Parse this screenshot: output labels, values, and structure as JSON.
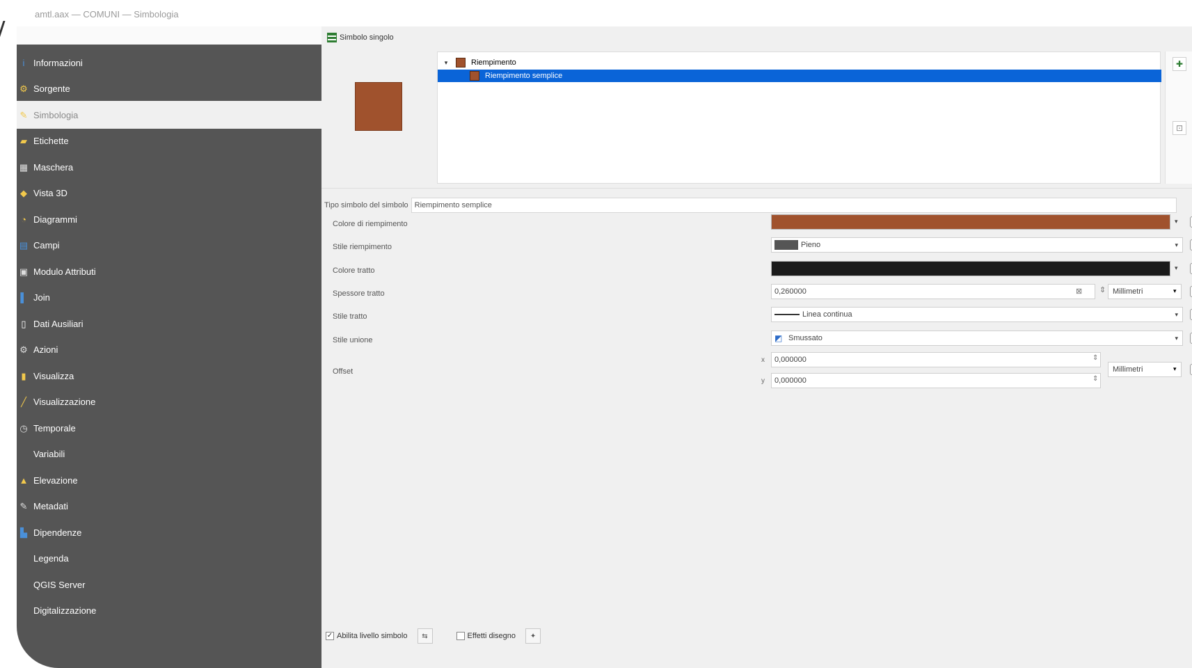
{
  "window": {
    "title": "amtl.aax — COMUNI — Simbologia"
  },
  "sidebar": {
    "items": [
      {
        "label": "Informazioni",
        "icon": "info-icon",
        "glyph": "i",
        "color": "#4a90d9"
      },
      {
        "label": "Sorgente",
        "icon": "source-icon",
        "glyph": "⚙",
        "color": "#f2c94c"
      },
      {
        "label": "Simbologia",
        "icon": "symbology-icon",
        "glyph": "✎",
        "color": "#f2c94c",
        "active": true
      },
      {
        "label": "Etichette",
        "icon": "labels-icon",
        "glyph": "▰",
        "color": "#f2c94c"
      },
      {
        "label": "Maschera",
        "icon": "mask-icon",
        "glyph": "▦",
        "color": "#dddddd"
      },
      {
        "label": "Vista 3D",
        "icon": "view3d-icon",
        "glyph": "◆",
        "color": "#f2c94c"
      },
      {
        "label": "Diagrammi",
        "icon": "diagrams-icon",
        "glyph": "◔",
        "color": "#f2c94c"
      },
      {
        "label": "Campi",
        "icon": "fields-icon",
        "glyph": "▤",
        "color": "#4a90d9"
      },
      {
        "label": "Modulo Attributi",
        "icon": "attributes-form-icon",
        "glyph": "▣",
        "color": "#dddddd"
      },
      {
        "label": "Join",
        "icon": "join-icon",
        "glyph": "▌",
        "color": "#4a90d9"
      },
      {
        "label": "Dati Ausiliari",
        "icon": "auxiliary-data-icon",
        "glyph": "▯",
        "color": "#ffffff"
      },
      {
        "label": "Azioni",
        "icon": "actions-icon",
        "glyph": "⚙",
        "color": "#dddddd"
      },
      {
        "label": "Visualizza",
        "icon": "display-icon",
        "glyph": "▮",
        "color": "#f2c94c"
      },
      {
        "label": "Visualizzazione",
        "icon": "rendering-icon",
        "glyph": "╱",
        "color": "#f2c94c"
      },
      {
        "label": "Temporale",
        "icon": "temporal-icon",
        "glyph": "◷",
        "color": "#dddddd"
      },
      {
        "label": "Variabili",
        "icon": "variables-icon",
        "glyph": "",
        "color": "#ffffff"
      },
      {
        "label": "Elevazione",
        "icon": "elevation-icon",
        "glyph": "▲",
        "color": "#f2c94c"
      },
      {
        "label": "Metadati",
        "icon": "metadata-icon",
        "glyph": "✎",
        "color": "#dddddd"
      },
      {
        "label": "Dipendenze",
        "icon": "dependencies-icon",
        "glyph": "▙",
        "color": "#4a90d9"
      },
      {
        "label": "Legenda",
        "icon": "legend-icon",
        "glyph": "",
        "color": "#ffffff"
      },
      {
        "label": "QGIS Server",
        "icon": "qgis-server-icon",
        "glyph": "",
        "color": "#ffffff"
      },
      {
        "label": "Digitalizzazione",
        "icon": "digitizing-icon",
        "glyph": "",
        "color": "#ffffff"
      }
    ]
  },
  "renderer": {
    "mode_label": "Simbolo singolo"
  },
  "symbol_tree": {
    "items": [
      {
        "label": "Riempimento",
        "selected": false
      },
      {
        "label": "Riempimento semplice",
        "selected": true
      }
    ],
    "swatch_color": "#a0522d"
  },
  "layer_type": {
    "label": "Tipo simbolo del simbolo",
    "value": "Riempimento semplice"
  },
  "properties": {
    "fill_color": {
      "label": "Colore di riempimento",
      "color": "#a0522d"
    },
    "fill_style": {
      "label": "Stile riempimento",
      "value": "Pieno"
    },
    "stroke_color": {
      "label": "Colore tratto",
      "color": "#1a1a1a"
    },
    "stroke_width": {
      "label": "Spessore tratto",
      "value": "0,260000",
      "unit": "Millimetri"
    },
    "stroke_style": {
      "label": "Stile tratto",
      "value": "Linea continua"
    },
    "join_style": {
      "label": "Stile unione",
      "value": "Smussato"
    },
    "offset": {
      "label": "Offset",
      "x_label": "x",
      "y_label": "y",
      "x": "0,000000",
      "y": "0,000000",
      "unit": "Millimetri"
    }
  },
  "bottom": {
    "enable_layer_label": "Abilita livello simbolo",
    "enable_checked": true,
    "draw_effects_label": "Effetti disegno",
    "draw_effects_checked": false
  }
}
